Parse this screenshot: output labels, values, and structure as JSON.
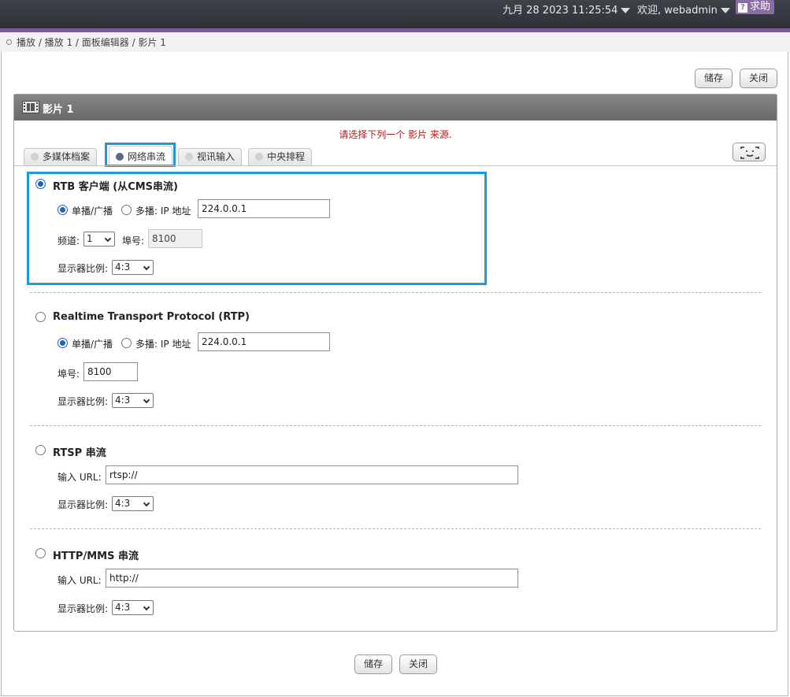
{
  "topbar": {
    "datetime": "九月 28 2023 11:25:54",
    "welcome": "欢迎, webadmin",
    "help_label": "求助",
    "help_glyph": "?"
  },
  "breadcrumb": "播放 / 播放 1 / 面板编辑器 / 影片 1",
  "buttons": {
    "save": "储存",
    "close": "关闭"
  },
  "panel": {
    "title": "影片 1",
    "notice": "请选择下列一个 影片 来源."
  },
  "tabs": [
    {
      "label": "多媒体档案",
      "active": false
    },
    {
      "label": "网络串流",
      "active": true
    },
    {
      "label": "视讯输入",
      "active": false
    },
    {
      "label": "中央排程",
      "active": false
    }
  ],
  "sources": {
    "rtb": {
      "title": "RTB 客户端 (从CMS串流)",
      "selected": true,
      "unicast_label": "单播/广播",
      "multicast_label": "多播: IP 地址",
      "ip_value": "224.0.0.1",
      "channel_label": "频道:",
      "channel_value": "1",
      "port_label": "埠号:",
      "port_value": "8100",
      "aspect_label": "显示器比例:",
      "aspect_value": "4:3"
    },
    "rtp": {
      "title": "Realtime Transport Protocol (RTP)",
      "selected": false,
      "unicast_label": "单播/广播",
      "multicast_label": "多播: IP 地址",
      "ip_value": "224.0.0.1",
      "port_label": "埠号:",
      "port_value": "8100",
      "aspect_label": "显示器比例:",
      "aspect_value": "4:3"
    },
    "rtsp": {
      "title": "RTSP 串流",
      "selected": false,
      "url_label": "输入 URL:",
      "url_value": "rtsp://",
      "aspect_label": "显示器比例:",
      "aspect_value": "4:3"
    },
    "http": {
      "title": "HTTP/MMS 串流",
      "selected": false,
      "url_label": "输入 URL:",
      "url_value": "http://",
      "aspect_label": "显示器比例:",
      "aspect_value": "4:3"
    }
  },
  "colors": {
    "header_bar": "#3a3d43",
    "accent_stripe": "#7b5a93",
    "highlight": "#1a9ad8",
    "notice_text": "#b01a1a"
  }
}
